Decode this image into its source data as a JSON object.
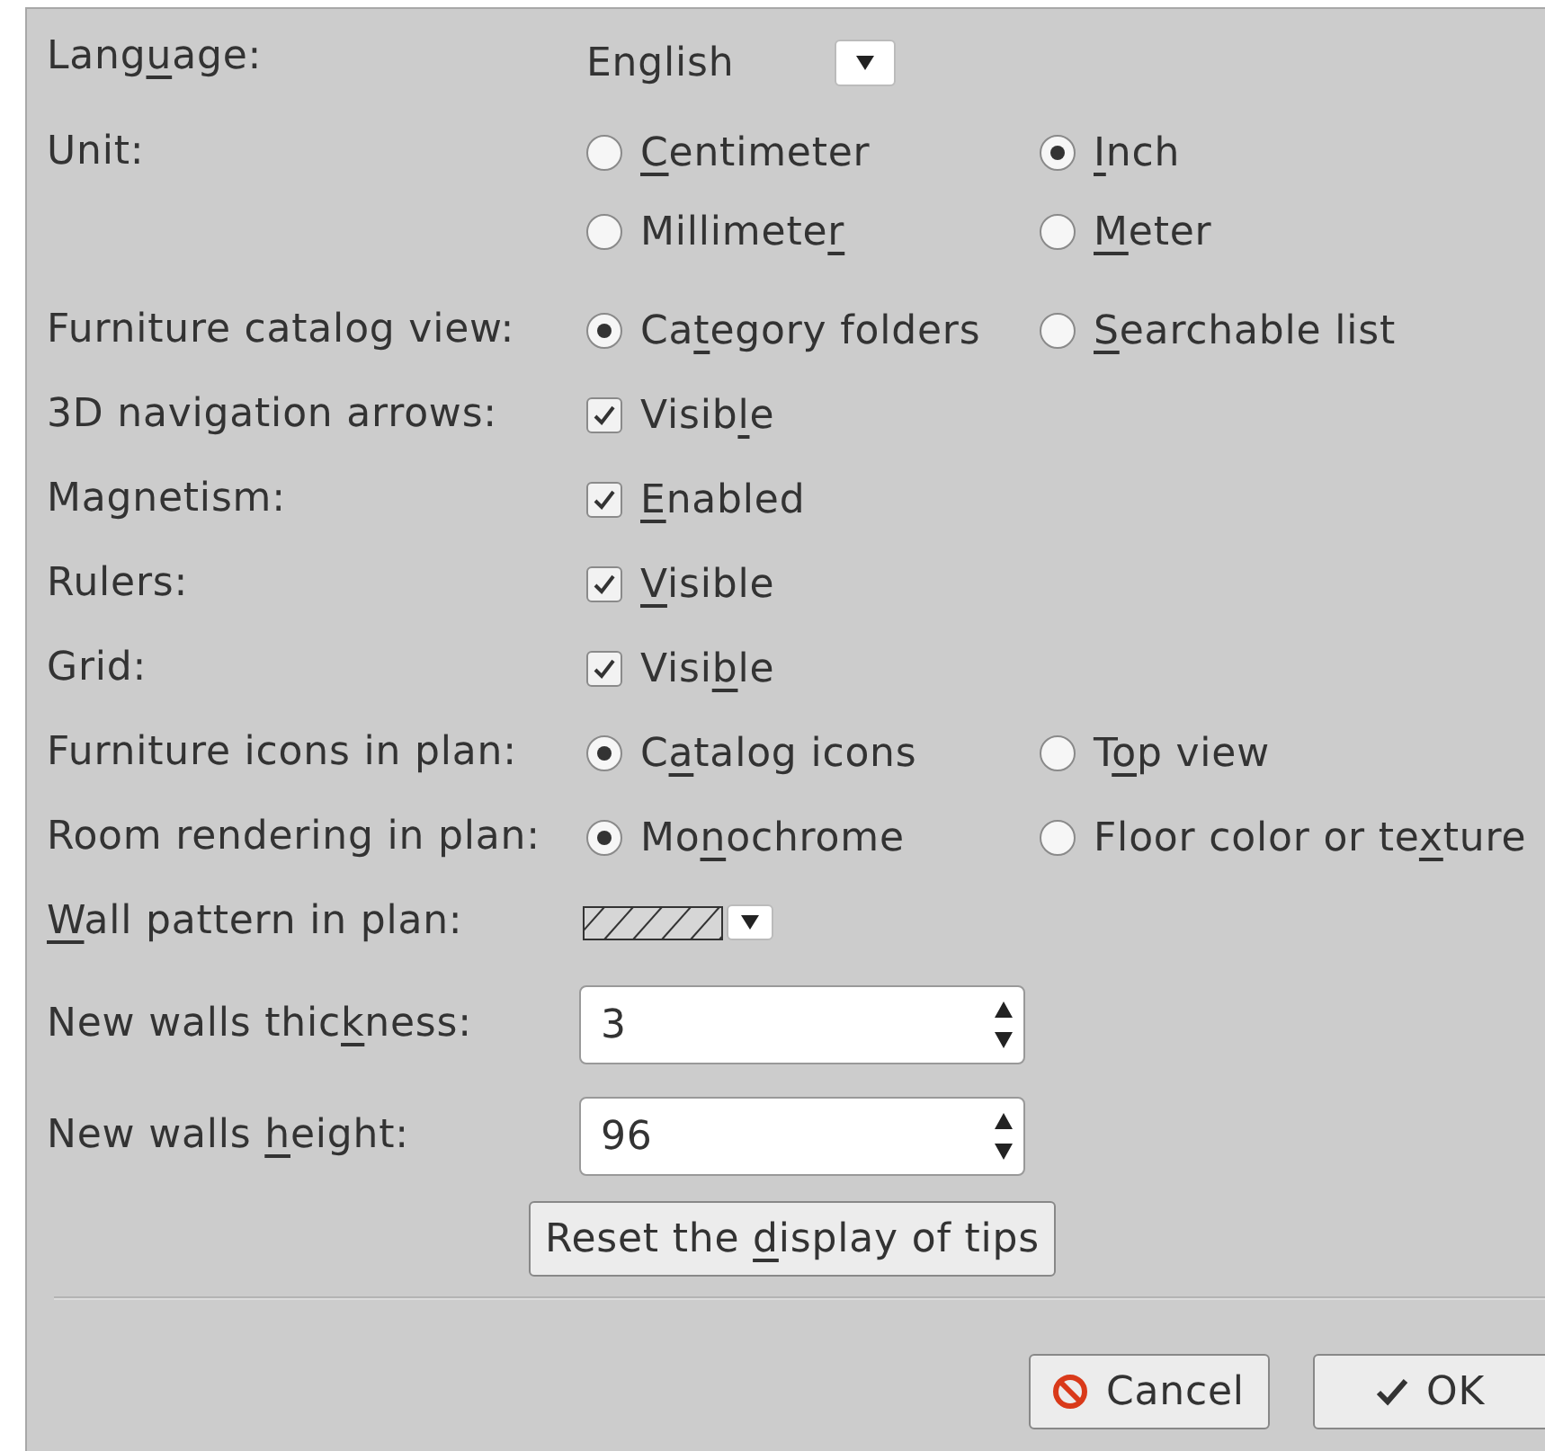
{
  "rows": [
    {
      "kind": "select",
      "label": {
        "before": "Lang",
        "key": "u",
        "after": "age:"
      },
      "value": "English"
    },
    {
      "kind": "radios",
      "label": {
        "before": "Unit:"
      },
      "options": [
        {
          "label": {
            "key": "C",
            "after": "entimeter"
          },
          "selected": false
        },
        {
          "label": {
            "key": "I",
            "after": "nch"
          },
          "selected": true
        },
        {
          "label": {
            "before": "Millimete",
            "key": "r"
          },
          "selected": false
        },
        {
          "label": {
            "key": "M",
            "after": "eter"
          },
          "selected": false
        }
      ]
    },
    {
      "kind": "radios",
      "label": {
        "before": "Furniture catalog view:"
      },
      "options": [
        {
          "label": {
            "before": "Ca",
            "key": "t",
            "after": "egory folders"
          },
          "selected": true
        },
        {
          "label": {
            "key": "S",
            "after": "earchable list"
          },
          "selected": false
        }
      ]
    },
    {
      "kind": "checkbox",
      "label": {
        "before": "3D navigation arrows:"
      },
      "option": {
        "label": {
          "before": "Visib",
          "key": "l",
          "after": "e"
        },
        "checked": true
      }
    },
    {
      "kind": "checkbox",
      "label": {
        "before": "Magnetism:"
      },
      "option": {
        "label": {
          "key": "E",
          "after": "nabled"
        },
        "checked": true
      }
    },
    {
      "kind": "checkbox",
      "label": {
        "before": "Rulers:"
      },
      "option": {
        "label": {
          "key": "V",
          "after": "isible"
        },
        "checked": true
      }
    },
    {
      "kind": "checkbox",
      "label": {
        "before": "Grid:"
      },
      "option": {
        "label": {
          "before": "Visi",
          "key": "b",
          "after": "le"
        },
        "checked": true
      }
    },
    {
      "kind": "radios",
      "label": {
        "before": "Furniture icons in plan:"
      },
      "options": [
        {
          "label": {
            "before": "C",
            "key": "a",
            "after": "talog icons"
          },
          "selected": true
        },
        {
          "label": {
            "before": "T",
            "key": "o",
            "after": "p view"
          },
          "selected": false
        }
      ]
    },
    {
      "kind": "radios",
      "label": {
        "before": "Room rendering in plan:"
      },
      "options": [
        {
          "label": {
            "before": "Mo",
            "key": "n",
            "after": "ochrome"
          },
          "selected": true
        },
        {
          "label": {
            "before": "Floor color or te",
            "key": "x",
            "after": "ture"
          },
          "selected": false
        }
      ]
    },
    {
      "kind": "pattern",
      "label": {
        "key": "W",
        "after": "all pattern in plan:"
      }
    },
    {
      "kind": "spinner",
      "label": {
        "before": "New walls thic",
        "key": "k",
        "after": "ness:"
      },
      "value": "3"
    },
    {
      "kind": "spinner",
      "label": {
        "before": "New walls ",
        "key": "h",
        "after": "eight:"
      },
      "value": "96"
    }
  ],
  "reset_button": {
    "before": "Reset the ",
    "key": "d",
    "after": "isplay of tips"
  },
  "buttons": [
    {
      "kind": "cancel",
      "label": "Cancel"
    },
    {
      "kind": "ok",
      "label": "OK"
    }
  ]
}
